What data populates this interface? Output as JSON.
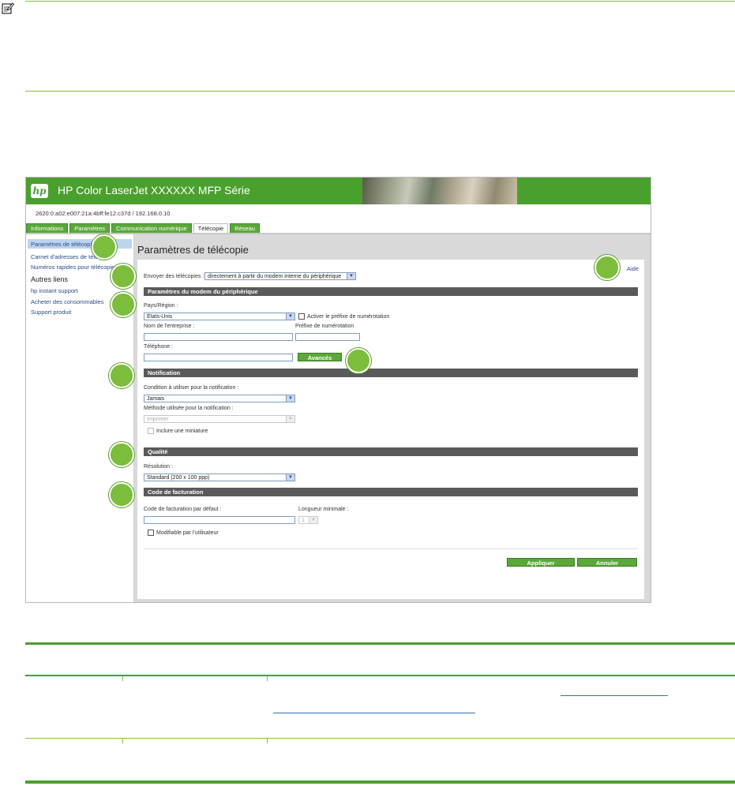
{
  "note_icon": "note-pencil-icon",
  "banner": {
    "logo": "hp",
    "title": "HP Color LaserJet XXXXXX MFP Série"
  },
  "address": "2620:0:a02:e007:21a:4bff:fe12:c37d / 192.168.0.10",
  "tabs": [
    {
      "label": "Informations"
    },
    {
      "label": "Paramètres"
    },
    {
      "label": "Communication numérique"
    },
    {
      "label": "Télécopie"
    },
    {
      "label": "Réseau"
    }
  ],
  "active_tab": "Télécopie",
  "sidebar": {
    "items": [
      {
        "label": "Paramètres de télécopie"
      },
      {
        "label": "Carnet d'adresses de télé..."
      },
      {
        "label": "Numéros rapides pour télécopie"
      }
    ],
    "other_heading": "Autres liens",
    "links": [
      {
        "label": "hp instant support"
      },
      {
        "label": "Acheter des consommables"
      },
      {
        "label": "Support produit"
      }
    ]
  },
  "main": {
    "title": "Paramètres de télécopie",
    "help": "Aide",
    "send_label": "Envoyer des télécopies :",
    "send_value": "directement à partir du modem interne du périphérique",
    "modem": {
      "heading": "Paramètres du modem du périphérique",
      "country_label": "Pays/Région :",
      "country_value": "États-Unis",
      "prefix_check": "Activer le préfixe de numérotation",
      "company_label": "Nom de l'entreprise :",
      "prefix_label": "Préfixe de numérotation",
      "phone_label": "Téléphone :",
      "advanced_button": "Avancés"
    },
    "notification": {
      "heading": "Notification",
      "condition_label": "Condition à utiliser pour la notification :",
      "condition_value": "Jamais",
      "method_label": "Méthode utilisée pour la notification :",
      "method_value": "Imprimer",
      "thumbnail_check": "Inclure une miniature"
    },
    "quality": {
      "heading": "Qualité",
      "resolution_label": "Résolution :",
      "resolution_value": "Standard (200 x 100 ppp)"
    },
    "billing": {
      "heading": "Code de facturation",
      "default_label": "Code de facturation par défaut :",
      "min_length_label": "Longueur minimale :",
      "min_length_value": "1",
      "user_editable_check": "Modifiable par l'utilisateur"
    },
    "apply_button": "Appliquer",
    "cancel_button": "Annuler"
  },
  "colors": {
    "brand_green": "#4aa02c",
    "callout_green": "#7cbd3b",
    "section_bar": "#5a5a5a"
  }
}
